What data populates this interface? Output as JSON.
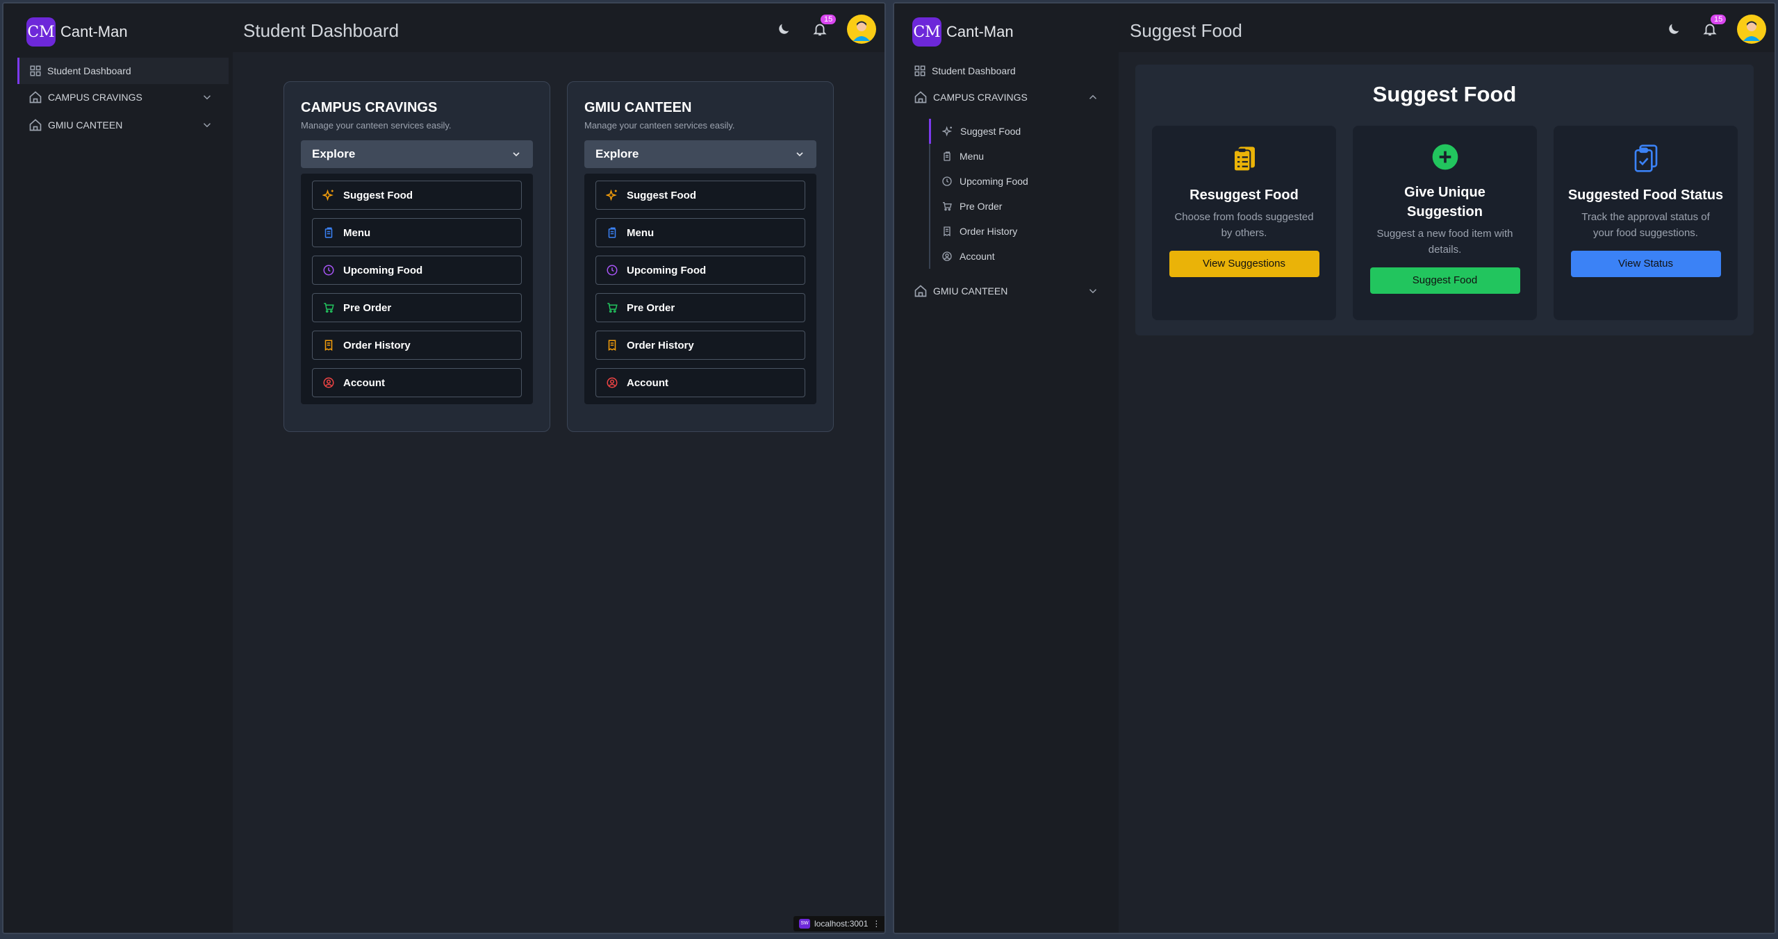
{
  "app": {
    "logo": "CM",
    "name": "Cant-Man",
    "notif_count": "15"
  },
  "left": {
    "title": "Student Dashboard",
    "sidebar": {
      "items": [
        {
          "label": "Student Dashboard"
        },
        {
          "label": "CAMPUS CRAVINGS"
        },
        {
          "label": "GMIU CANTEEN"
        }
      ]
    },
    "cards": [
      {
        "title": "CAMPUS CRAVINGS",
        "subtitle": "Manage your canteen services easily.",
        "explore": "Explore",
        "items": [
          "Suggest Food",
          "Menu",
          "Upcoming Food",
          "Pre Order",
          "Order History",
          "Account"
        ]
      },
      {
        "title": "GMIU CANTEEN",
        "subtitle": "Manage your canteen services easily.",
        "explore": "Explore",
        "items": [
          "Suggest Food",
          "Menu",
          "Upcoming Food",
          "Pre Order",
          "Order History",
          "Account"
        ]
      }
    ],
    "status_url": "localhost:3001",
    "status_badge": "SW"
  },
  "right": {
    "title": "Suggest Food",
    "sidebar": {
      "dashboard": "Student Dashboard",
      "group1": "CAMPUS CRAVINGS",
      "sub_items": [
        "Suggest Food",
        "Menu",
        "Upcoming Food",
        "Pre Order",
        "Order History",
        "Account"
      ],
      "group2": "GMIU CANTEEN"
    },
    "panel": {
      "heading": "Suggest Food",
      "options": [
        {
          "title": "Resuggest Food",
          "desc": "Choose from foods suggested by others.",
          "button": "View Suggestions",
          "color": "#eab308"
        },
        {
          "title": "Give Unique Suggestion",
          "desc": "Suggest a new food item with details.",
          "button": "Suggest Food",
          "color": "#22c55e"
        },
        {
          "title": "Suggested Food Status",
          "desc": "Track the approval status of your food suggestions.",
          "button": "View Status",
          "color": "#3b82f6"
        }
      ]
    }
  },
  "icons": {
    "suggest": "sparkles-icon",
    "menu": "book-icon",
    "upcoming": "clock-icon",
    "preorder": "cart-icon",
    "history": "receipt-icon",
    "account": "user-circle-icon"
  }
}
